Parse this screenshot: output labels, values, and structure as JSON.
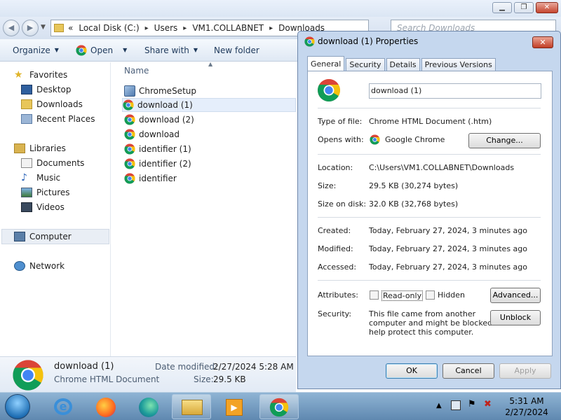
{
  "explorer": {
    "address": {
      "segments": [
        "Local Disk (C:)",
        "Users",
        "VM1.COLLABNET",
        "Downloads"
      ],
      "chevron": "«",
      "separator": "▸"
    },
    "search": {
      "placeholder": "Search Downloads"
    },
    "toolbar": {
      "organize": "Organize",
      "open": "Open",
      "share_with": "Share with",
      "new_folder": "New folder"
    },
    "sidebar": {
      "favorites": "Favorites",
      "desktop": "Desktop",
      "downloads": "Downloads",
      "recent_places": "Recent Places",
      "libraries": "Libraries",
      "documents": "Documents",
      "music": "Music",
      "pictures": "Pictures",
      "videos": "Videos",
      "computer": "Computer",
      "network": "Network"
    },
    "column_header": "Name",
    "files": [
      {
        "name": "ChromeSetup",
        "icon": "installer-icon"
      },
      {
        "name": "download (1)",
        "icon": "chrome-icon"
      },
      {
        "name": "download (2)",
        "icon": "chrome-icon"
      },
      {
        "name": "download",
        "icon": "chrome-icon"
      },
      {
        "name": "identifier (1)",
        "icon": "chrome-icon"
      },
      {
        "name": "identifier (2)",
        "icon": "chrome-icon"
      },
      {
        "name": "identifier",
        "icon": "chrome-icon"
      }
    ],
    "details": {
      "name": "download (1)",
      "type": "Chrome HTML Document",
      "date_label": "Date modified:",
      "date_value": "2/27/2024 5:28 AM",
      "size_label": "Size:",
      "size_value": "29.5 KB"
    }
  },
  "dialog": {
    "title": "download (1) Properties",
    "close": "✕",
    "tabs": [
      "General",
      "Security",
      "Details",
      "Previous Versions"
    ],
    "name_value": "download (1)",
    "type_label": "Type of file:",
    "type_value": "Chrome HTML Document (.htm)",
    "opens_label": "Opens with:",
    "opens_value": "Google Chrome",
    "change_button": "Change...",
    "location_label": "Location:",
    "location_value": "C:\\Users\\VM1.COLLABNET\\Downloads",
    "size_label": "Size:",
    "size_value": "29.5 KB (30,274 bytes)",
    "size_on_disk_label": "Size on disk:",
    "size_on_disk_value": "32.0 KB (32,768 bytes)",
    "created_label": "Created:",
    "created_value": "Today, February 27, 2024, 3 minutes ago",
    "modified_label": "Modified:",
    "modified_value": "Today, February 27, 2024, 3 minutes ago",
    "accessed_label": "Accessed:",
    "accessed_value": "Today, February 27, 2024, 3 minutes ago",
    "attributes_label": "Attributes:",
    "read_only_label": "Read-only",
    "hidden_label": "Hidden",
    "advanced_button": "Advanced...",
    "security_label": "Security:",
    "security_line1": "This file came from another",
    "security_line2": "computer and might be blocked to",
    "security_line3": "help protect this computer.",
    "unblock_button": "Unblock",
    "ok_button": "OK",
    "cancel_button": "Cancel",
    "apply_button": "Apply"
  },
  "taskbar": {
    "time": "5:31 AM",
    "date": "2/27/2024",
    "items": [
      "ie-icon",
      "firefox-icon",
      "edge-icon",
      "explorer-icon",
      "media-player-icon",
      "chrome-icon"
    ]
  },
  "colors": {
    "chrome_red": "#db4437",
    "chrome_yellow": "#f4c20d",
    "chrome_green": "#0f9d58",
    "chrome_blue": "#4285f4",
    "selection": "#e5eefb"
  }
}
